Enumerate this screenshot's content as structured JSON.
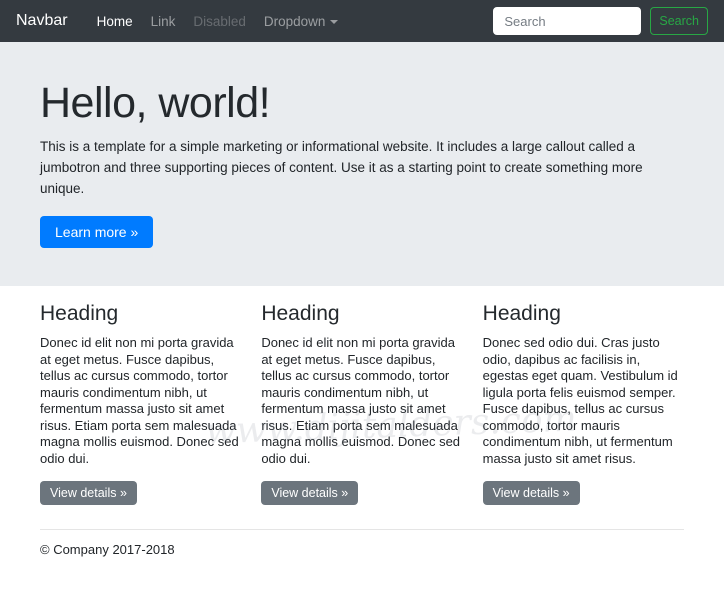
{
  "colors": {
    "navbar_bg": "#343a40",
    "jumbotron_bg": "#e9ecef",
    "primary": "#007bff",
    "secondary": "#6c757d",
    "success": "#28a745",
    "text": "#212529"
  },
  "navbar": {
    "brand": "Navbar",
    "items": [
      {
        "label": "Home",
        "state": "active"
      },
      {
        "label": "Link",
        "state": "normal"
      },
      {
        "label": "Disabled",
        "state": "disabled"
      },
      {
        "label": "Dropdown",
        "state": "dropdown"
      }
    ],
    "search": {
      "placeholder": "Search",
      "button_label": "Search"
    }
  },
  "jumbotron": {
    "heading": "Hello, world!",
    "text": "This is a template for a simple marketing or informational website. It includes a large callout called a jumbotron and three supporting pieces of content. Use it as a starting point to create something more unique.",
    "button_label": "Learn more »"
  },
  "columns": [
    {
      "heading": "Heading",
      "text": "Donec id elit non mi porta gravida at eget metus. Fusce dapibus, tellus ac cursus commodo, tortor mauris condimentum nibh, ut fermentum massa justo sit amet risus. Etiam porta sem malesuada magna mollis euismod. Donec sed odio dui.",
      "button_label": "View details »"
    },
    {
      "heading": "Heading",
      "text": "Donec id elit non mi porta gravida at eget metus. Fusce dapibus, tellus ac cursus commodo, tortor mauris condimentum nibh, ut fermentum massa justo sit amet risus. Etiam porta sem malesuada magna mollis euismod. Donec sed odio dui.",
      "button_label": "View details »"
    },
    {
      "heading": "Heading",
      "text": "Donec sed odio dui. Cras justo odio, dapibus ac facilisis in, egestas eget quam. Vestibulum id ligula porta felis euismod semper. Fusce dapibus, tellus ac cursus commodo, tortor mauris condimentum nibh, ut fermentum massa justo sit amet risus.",
      "button_label": "View details »"
    }
  ],
  "footer": {
    "copyright": "© Company 2017-2018"
  },
  "watermark": "www.dijitalders.com"
}
